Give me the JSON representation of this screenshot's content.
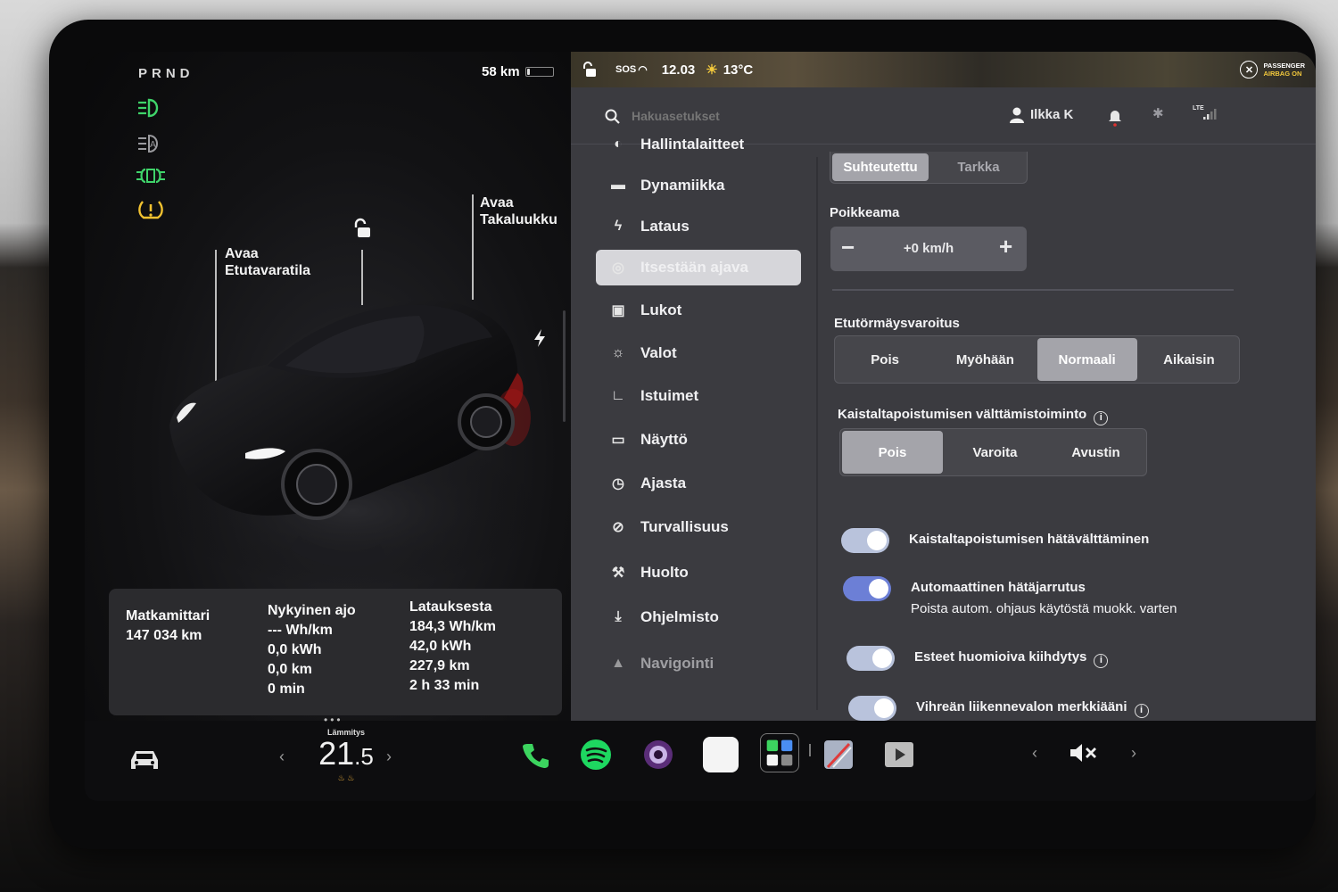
{
  "left_panel": {
    "gear": "PRND",
    "range": "58 km",
    "range_fraction": 0.12,
    "frunk_label_line1": "Avaa",
    "frunk_label_line2": "Etutavaratila",
    "trunk_label_line1": "Avaa",
    "trunk_label_line2": "Takaluukku",
    "indicators": [
      "headlight-icon",
      "auto-headlight-icon",
      "parking-light-icon",
      "tire-pressure-warning-icon"
    ],
    "stats": {
      "odo_title": "Matkamittari",
      "odo_value": "147 034 km",
      "current_title": "Nykyinen ajo",
      "current_wh": "--- Wh/km",
      "current_kwh": "0,0 kWh",
      "current_km": "0,0 km",
      "current_min": "0 min",
      "charge_title": "Latauksesta",
      "charge_wh": "184,3 Wh/km",
      "charge_kwh": "42,0 kWh",
      "charge_km": "227,9 km",
      "charge_time": "2 h 33 min"
    }
  },
  "status_bar": {
    "sos": "SOS",
    "time": "12.03",
    "temperature": "13°C",
    "airbag_line1": "PASSENGER",
    "airbag_line2": "AIRBAG ON"
  },
  "header": {
    "search_placeholder": "Hakuasetukset",
    "user": "Ilkka K",
    "lte": "LTE"
  },
  "menu": [
    {
      "label": "Hallintalaitteet",
      "icon": "toggle-icon"
    },
    {
      "label": "Dynamiikka",
      "icon": "car-icon"
    },
    {
      "label": "Lataus",
      "icon": "bolt-icon"
    },
    {
      "label": "Itsestään ajava",
      "icon": "steering-wheel-icon",
      "active": true
    },
    {
      "label": "Lukot",
      "icon": "lock-icon"
    },
    {
      "label": "Valot",
      "icon": "sun-icon"
    },
    {
      "label": "Istuimet",
      "icon": "seat-icon"
    },
    {
      "label": "Näyttö",
      "icon": "display-icon"
    },
    {
      "label": "Ajasta",
      "icon": "alarm-clock-icon"
    },
    {
      "label": "Turvallisuus",
      "icon": "alert-circle-icon"
    },
    {
      "label": "Huolto",
      "icon": "wrench-icon"
    },
    {
      "label": "Ohjelmisto",
      "icon": "download-icon"
    },
    {
      "label": "Navigointi",
      "icon": "navigation-icon"
    }
  ],
  "content": {
    "speed_mode": {
      "options": [
        "Suhteutettu",
        "Tarkka"
      ],
      "selected": "Suhteutettu"
    },
    "offset_label": "Poikkeama",
    "offset_value": "+0 km/h",
    "fcw_label": "Etutörmäysvaroitus",
    "fcw": {
      "options": [
        "Pois",
        "Myöhään",
        "Normaali",
        "Aikaisin"
      ],
      "selected": "Normaali"
    },
    "lane_label": "Kaistaltapoistumisen välttämistoiminto",
    "lane": {
      "options": [
        "Pois",
        "Varoita",
        "Avustin"
      ],
      "selected": "Pois"
    },
    "toggles": [
      {
        "label": "Kaistaltapoistumisen hätävälttäminen",
        "on": true
      },
      {
        "label": "Automaattinen hätäjarrutus",
        "sub": "Poista autom. ohjaus käytöstä muokk. varten",
        "on": true
      },
      {
        "label": "Esteet huomioiva kiihdytys",
        "on": true
      },
      {
        "label": "Vihreän liikennevalon merkkiääni",
        "on": true
      }
    ]
  },
  "dock": {
    "climate_label": "Lämmitys",
    "climate_temp_whole": "21",
    "climate_temp_frac": ".5",
    "apps": [
      "phone-icon",
      "spotify-icon",
      "camera-icon",
      "notes-icon",
      "app-launcher-icon",
      "navigation-app-icon",
      "theater-icon"
    ],
    "volume_icon": "mute-icon"
  }
}
